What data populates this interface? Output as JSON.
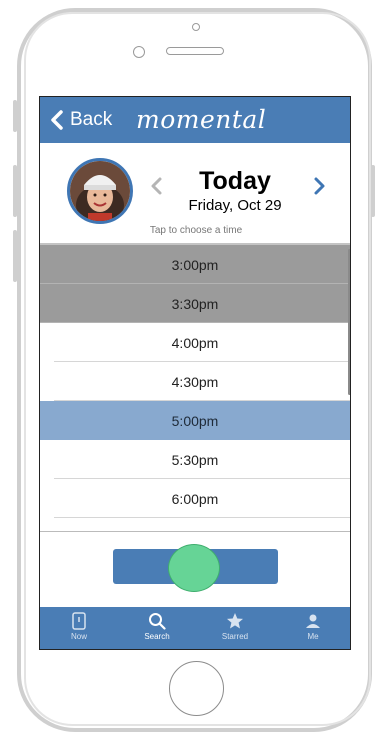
{
  "header": {
    "back_label": "Back",
    "logo": "momental"
  },
  "date": {
    "title": "Today",
    "subtitle": "Friday, Oct 29",
    "hint": "Tap to choose a time"
  },
  "slots": [
    {
      "time": "3:00pm",
      "state": "unavailable"
    },
    {
      "time": "3:30pm",
      "state": "unavailable"
    },
    {
      "time": "4:00pm",
      "state": "available"
    },
    {
      "time": "4:30pm",
      "state": "available"
    },
    {
      "time": "5:00pm",
      "state": "selected"
    },
    {
      "time": "5:30pm",
      "state": "available"
    },
    {
      "time": "6:00pm",
      "state": "available"
    }
  ],
  "tabs": [
    {
      "label": "Now",
      "icon": "phone-icon"
    },
    {
      "label": "Search",
      "icon": "search-icon"
    },
    {
      "label": "Starred",
      "icon": "star-icon"
    },
    {
      "label": "Me",
      "icon": "person-icon"
    }
  ],
  "colors": {
    "brand": "#4a7db5",
    "selected": "#88a9cf",
    "unavailable": "#9b9b9b",
    "accent_dot": "#66d496"
  }
}
